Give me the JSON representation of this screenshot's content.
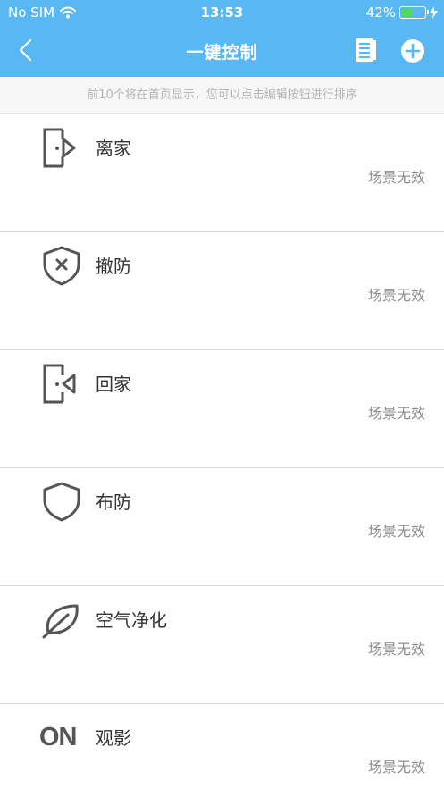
{
  "status_bar": {
    "carrier": "No SIM",
    "time": "13:53",
    "battery": "42%",
    "battery_level": 0.42
  },
  "header": {
    "title": "一键控制",
    "back_icon": "chevron-left-icon",
    "list_icon": "list-document-icon",
    "add_icon": "plus-circle-icon"
  },
  "hint": "前10个将在首页显示，您可以点击编辑按钮进行排序",
  "scenes": [
    {
      "name": "离家",
      "status": "场景无效",
      "icon": "leave-home-icon"
    },
    {
      "name": "撤防",
      "status": "场景无效",
      "icon": "disarm-shield-icon"
    },
    {
      "name": "回家",
      "status": "场景无效",
      "icon": "arrive-home-icon"
    },
    {
      "name": "布防",
      "status": "场景无效",
      "icon": "arm-shield-icon"
    },
    {
      "name": "空气净化",
      "status": "场景无效",
      "icon": "leaf-icon"
    },
    {
      "name": "观影",
      "status": "场景无效",
      "icon": "on-text-icon",
      "icon_text": "ON"
    }
  ],
  "colors": {
    "header": "#59b8f3",
    "battery_fill": "#4cd964",
    "icon": "#555555"
  }
}
